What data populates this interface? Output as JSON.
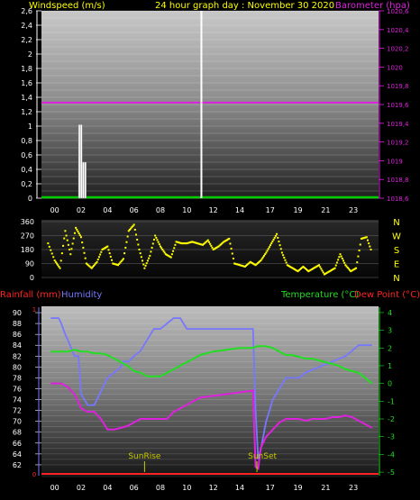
{
  "header": {
    "wind_title": "Windspeed (m/s)",
    "date_title": "24 hour graph day : November 30 2020",
    "baro_title": "Barometer (hpa)"
  },
  "bottom_header": {
    "rain_title": "Rainfall (mm)",
    "hum_title": "Humidity",
    "temp_title": "Temperature (°C)",
    "dew_title": "Dew Point (°C)"
  },
  "annotations": {
    "sunrise": "SunRise",
    "sunset": "SunSet"
  },
  "colors": {
    "wind": "#ffffff",
    "baro": "#dd22dd",
    "direction": "#ffff00",
    "rain": "#ff2222",
    "humidity": "#7777ff",
    "temperature": "#22dd22",
    "dew_point": "#dd22dd",
    "title_yellow": "#ffff00",
    "ground": "#00cc00"
  },
  "chart_data": [
    {
      "type": "bar",
      "title": "24 hour graph day : November 30 2020",
      "ylabel": "Windspeed (m/s)",
      "y2label": "Barometer (hpa)",
      "ylim": [
        0,
        2.6
      ],
      "y2lim": [
        1018.6,
        1020.6
      ],
      "xlim": [
        -1,
        24.5
      ],
      "x_ticks": [
        "00",
        "02",
        "04",
        "06",
        "08",
        "10",
        "12",
        "14",
        "17",
        "19",
        "21",
        "23"
      ],
      "y_ticks": [
        "0",
        "0,2",
        "0,4",
        "0,6",
        "0,8",
        "1",
        "1,2",
        "1,4",
        "1,6",
        "1,8",
        "2",
        "2,2",
        "2,4",
        "2,6"
      ],
      "y2_ticks": [
        "1018,6",
        "1018,8",
        "1019",
        "1019,2",
        "1019,4",
        "1019,6",
        "1019,8",
        "1020",
        "1020,2",
        "1020,4",
        "1020,6"
      ],
      "grid": true,
      "series": [
        {
          "name": "Windspeed",
          "x": [
            1.9,
            2.05,
            2.2,
            2.35
          ],
          "values": [
            1.02,
            1.02,
            0.5,
            0.5
          ]
        },
        {
          "name": "Barometer",
          "x": [
            -1,
            24.5
          ],
          "values": [
            1019.62,
            1019.62
          ]
        }
      ],
      "cursor_hour": 11.1
    },
    {
      "type": "scatter",
      "ylabel": "Wind direction",
      "ylim": [
        0,
        360
      ],
      "xlim": [
        -1,
        24.5
      ],
      "y_ticks": [
        "0",
        "90",
        "180",
        "270",
        "360"
      ],
      "compass": [
        "N",
        "W",
        "S",
        "E",
        "N"
      ],
      "series": [
        {
          "name": "Direction",
          "x": [
            -0.5,
            0,
            0.4,
            0.8,
            1.2,
            1.6,
            2,
            2.4,
            2.8,
            3.2,
            3.6,
            4,
            4.4,
            4.8,
            5.2,
            5.6,
            6,
            6.4,
            6.8,
            7.2,
            7.6,
            8,
            8.4,
            8.8,
            9.2,
            9.6,
            10,
            10.4,
            10.8,
            11.2,
            11.6,
            12,
            12.4,
            12.8,
            13.2,
            13.6,
            14,
            14.4,
            14.8,
            15.2,
            15.6,
            16,
            16.4,
            16.8,
            17.2,
            17.6,
            18,
            18.4,
            18.8,
            19.2,
            19.6,
            20,
            20.4,
            20.8,
            21.2,
            21.6,
            22,
            22.4,
            22.8,
            23.2,
            23.6,
            24
          ],
          "values": [
            220,
            110,
            60,
            300,
            150,
            320,
            260,
            90,
            60,
            100,
            180,
            200,
            90,
            80,
            120,
            300,
            340,
            180,
            60,
            140,
            270,
            200,
            150,
            130,
            230,
            220,
            220,
            230,
            220,
            210,
            240,
            180,
            200,
            230,
            250,
            90,
            80,
            70,
            100,
            80,
            110,
            160,
            220,
            280,
            160,
            80,
            60,
            40,
            70,
            40,
            60,
            80,
            20,
            40,
            60,
            150,
            80,
            40,
            60,
            250,
            260,
            160
          ]
        }
      ]
    },
    {
      "type": "line",
      "ylabel": "Humidity",
      "y2label": "Temperature (°C)",
      "ylim": [
        60,
        91
      ],
      "y2lim": [
        -5.2,
        4.3
      ],
      "rain_ylim": [
        0,
        1
      ],
      "xlim": [
        -1,
        24.5
      ],
      "x_ticks": [
        "00",
        "02",
        "04",
        "06",
        "08",
        "10",
        "12",
        "14",
        "17",
        "19",
        "21",
        "23"
      ],
      "y_ticks": [
        "62",
        "64",
        "66",
        "68",
        "70",
        "72",
        "74",
        "76",
        "78",
        "80",
        "82",
        "84",
        "86",
        "88",
        "90"
      ],
      "y2_ticks": [
        "-5",
        "-4",
        "-3",
        "-2",
        "-1",
        "0",
        "1",
        "2",
        "3",
        "4"
      ],
      "rain_ticks": [
        "0",
        "1"
      ],
      "sunrise_hour": 6.8,
      "sunset_hour": 15.3,
      "series": [
        {
          "name": "Rainfall",
          "x": [
            -1,
            24.5
          ],
          "values": [
            0,
            0
          ]
        },
        {
          "name": "Humidity",
          "x": [
            -0.3,
            0.3,
            0.5,
            0.8,
            1,
            1.5,
            1.8,
            2,
            2.5,
            3,
            3.2,
            3.6,
            4,
            4.5,
            5,
            5.2,
            5.6,
            6,
            6.5,
            7,
            7.5,
            8,
            8.5,
            9,
            9.5,
            10,
            10.5,
            11,
            12,
            13,
            14,
            15,
            15.2,
            15.4,
            15.6,
            16,
            16.5,
            17,
            17.5,
            18,
            18.5,
            19,
            20,
            21,
            22,
            22.5,
            23,
            23.5,
            24
          ],
          "values": [
            89,
            89,
            88,
            86,
            85,
            82,
            82,
            75,
            73,
            73,
            74,
            76,
            78,
            79,
            80,
            81,
            81,
            82,
            83,
            85,
            87,
            87,
            88,
            89,
            89,
            87,
            87,
            87,
            87,
            87,
            87,
            87,
            72,
            63,
            65,
            70,
            74,
            76,
            78,
            78,
            78,
            79,
            80,
            81,
            82,
            83,
            84,
            84,
            84
          ]
        },
        {
          "name": "Temperature",
          "x": [
            -0.3,
            0.5,
            1,
            1.5,
            2,
            2.5,
            3,
            3.5,
            4,
            4.5,
            5,
            5.5,
            6,
            6.5,
            7,
            7.5,
            8,
            8.5,
            9,
            9.5,
            10,
            10.5,
            11,
            12,
            13,
            14,
            15,
            15.3,
            16,
            16.5,
            17,
            17.5,
            18,
            18.5,
            19,
            19.5,
            20,
            20.5,
            21,
            21.5,
            22,
            22.5,
            23,
            23.5,
            24
          ],
          "values": [
            1.8,
            1.8,
            1.8,
            1.9,
            1.8,
            1.8,
            1.7,
            1.7,
            1.6,
            1.4,
            1.2,
            1.0,
            0.7,
            0.6,
            0.4,
            0.4,
            0.4,
            0.6,
            0.8,
            1.0,
            1.2,
            1.4,
            1.6,
            1.8,
            1.9,
            2.0,
            2.0,
            2.1,
            2.1,
            2.0,
            1.8,
            1.6,
            1.6,
            1.5,
            1.4,
            1.4,
            1.3,
            1.2,
            1.1,
            1.0,
            0.8,
            0.7,
            0.6,
            0.3,
            0.0
          ]
        },
        {
          "name": "Dew Point",
          "x": [
            -0.3,
            0.5,
            1,
            1.5,
            2,
            2.5,
            3,
            3.5,
            4,
            4.5,
            5,
            5.5,
            6,
            6.5,
            7,
            7.5,
            8,
            8.5,
            9,
            9.5,
            10,
            10.5,
            11,
            12,
            13,
            14,
            15,
            15.2,
            15.4,
            15.6,
            16,
            16.5,
            17,
            17.5,
            18,
            18.5,
            19,
            19.5,
            20,
            20.5,
            21,
            21.5,
            22,
            22.5,
            23,
            23.5,
            24
          ],
          "values": [
            0.0,
            0.0,
            -0.2,
            -0.6,
            -1.4,
            -1.6,
            -1.6,
            -2.0,
            -2.6,
            -2.6,
            -2.5,
            -2.4,
            -2.2,
            -2.0,
            -2.0,
            -2.0,
            -2.0,
            -2.0,
            -1.6,
            -1.4,
            -1.2,
            -1.0,
            -0.8,
            -0.7,
            -0.6,
            -0.5,
            -0.4,
            -4.7,
            -4.8,
            -3.6,
            -3.0,
            -2.6,
            -2.2,
            -2.0,
            -2.0,
            -2.0,
            -2.1,
            -2.0,
            -2.0,
            -2.0,
            -1.9,
            -1.9,
            -1.8,
            -1.9,
            -2.1,
            -2.3,
            -2.5
          ]
        }
      ]
    }
  ]
}
